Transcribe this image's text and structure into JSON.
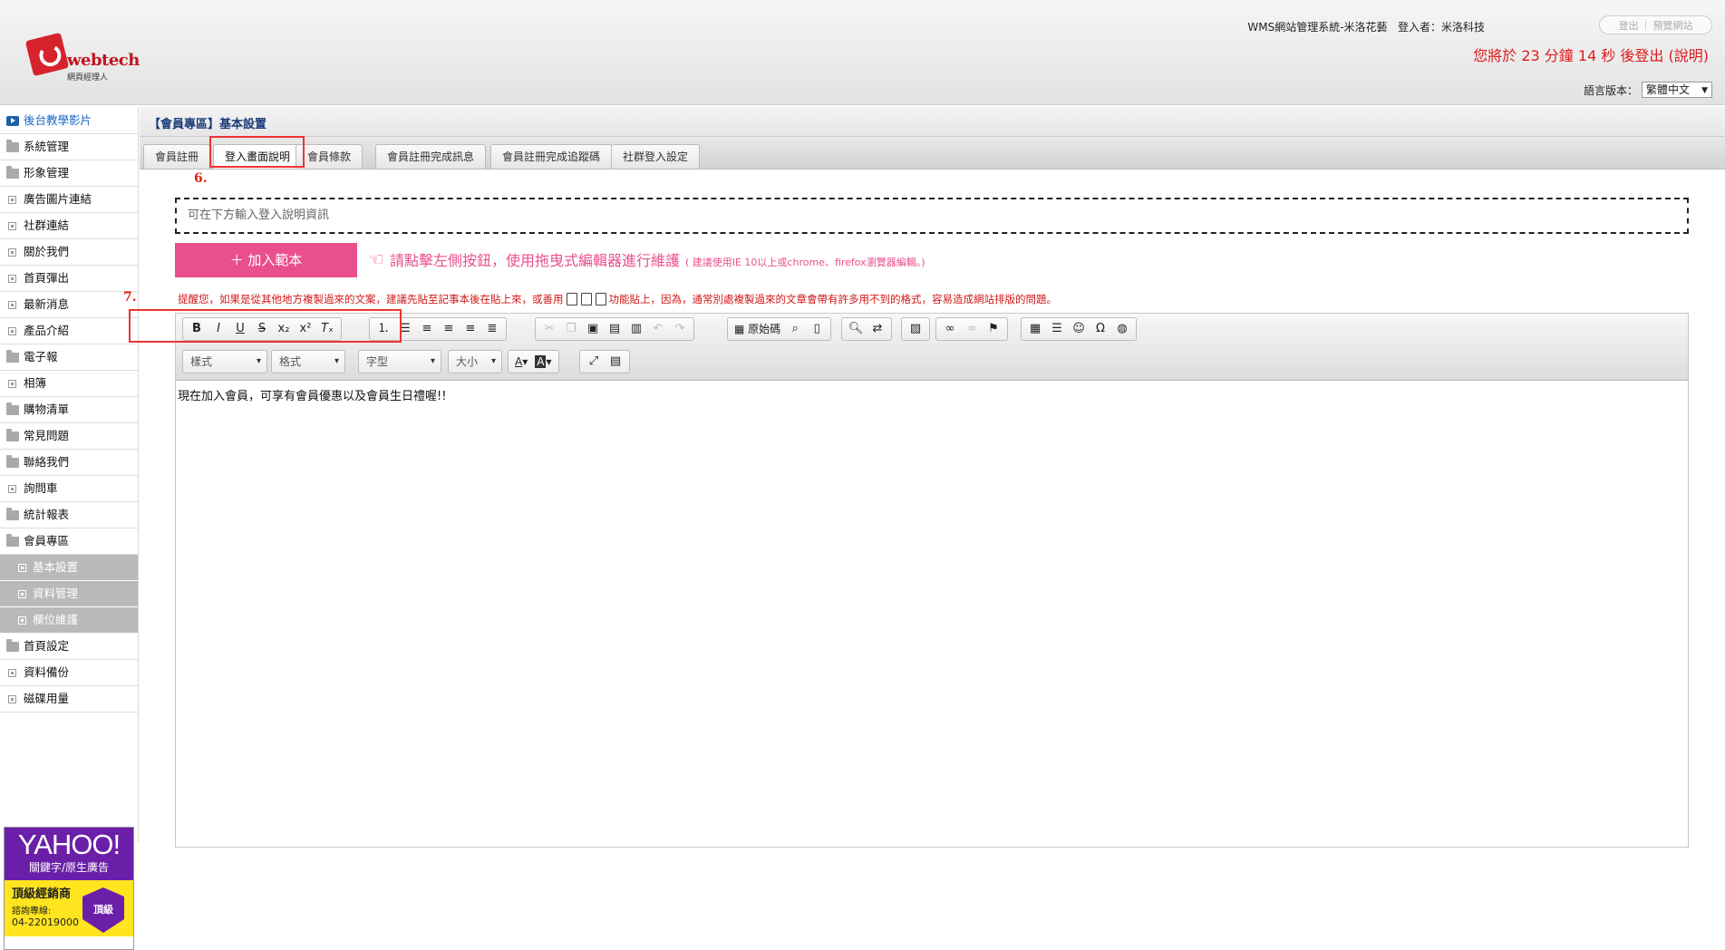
{
  "header": {
    "logo_word": "webtech",
    "logo_sub": "網頁經理人",
    "system_title": "WMS網站管理系統-米洛花藝",
    "user_label": "登入者：米洛科技",
    "logout": "登出",
    "preview": "預覽網站",
    "countdown": "您將於 23 分鐘 14 秒 後登出 (說明)",
    "lang_label": "語言版本：",
    "lang_value": "繁體中文"
  },
  "sidebar": {
    "items": [
      {
        "label": "後台教學影片",
        "icon": "video-icon"
      },
      {
        "label": "系統管理",
        "icon": "folder-icon"
      },
      {
        "label": "形象管理",
        "icon": "folder-icon"
      },
      {
        "label": "廣告圖片連結",
        "icon": "box-icon"
      },
      {
        "label": "社群連結",
        "icon": "box-icon"
      },
      {
        "label": "關於我們",
        "icon": "box-icon"
      },
      {
        "label": "首頁彈出",
        "icon": "box-icon"
      },
      {
        "label": "最新消息",
        "icon": "box-icon"
      },
      {
        "label": "產品介紹",
        "icon": "box-icon"
      },
      {
        "label": "電子報",
        "icon": "folder-icon"
      },
      {
        "label": "相簿",
        "icon": "box-icon"
      },
      {
        "label": "購物清單",
        "icon": "folder-icon"
      },
      {
        "label": "常見問題",
        "icon": "folder-icon"
      },
      {
        "label": "聯絡我們",
        "icon": "folder-icon"
      },
      {
        "label": "詢問車",
        "icon": "box-icon"
      },
      {
        "label": "統計報表",
        "icon": "folder-icon"
      },
      {
        "label": "會員專區",
        "icon": "folder-open-icon"
      }
    ],
    "sub_items": [
      "基本設置",
      "資料管理",
      "欄位維護"
    ],
    "items_after": [
      {
        "label": "首頁設定",
        "icon": "folder-icon"
      },
      {
        "label": "資料備份",
        "icon": "box-icon"
      },
      {
        "label": "磁碟用量",
        "icon": "box-icon"
      }
    ],
    "ad": {
      "logo": "YAHOO!",
      "tag": "關鍵字/原生廣告",
      "title": "頂級經銷商",
      "phone_label": "諮詢專線:",
      "phone": "04-22019000",
      "badge": "頂級"
    }
  },
  "main": {
    "title": "【會員專區】基本設置",
    "tabs": [
      "會員註冊",
      "登入畫面說明",
      "會員條款",
      "會員註冊完成訊息",
      "會員註冊完成追蹤碼",
      "社群登入設定"
    ],
    "active_tab": 1,
    "step6": "6.",
    "step7": "7.",
    "desc_placeholder": "可在下方輸入登入說明資訊",
    "add_template": "＋ 加入範本",
    "hint_text": "請點擊左側按鈕，使用拖曳式編輯器進行維護",
    "hint_small": "( 建議使用IE 10以上或chrome、firefox瀏覽器編輯。)",
    "warn_before": "提醒您，如果是從其他地方複製過來的文案，建議先貼至記事本後在貼上來，或善用",
    "warn_after": "功能貼上，因為，通常別處複製過來的文章會帶有許多用不到的格式，容易造成網站排版的問題。"
  },
  "editor": {
    "source_label": "原始碼",
    "combos": [
      "樣式",
      "格式",
      "字型",
      "大小"
    ],
    "content": "現在加入會員，可享有會員優惠以及會員生日禮喔!!"
  }
}
